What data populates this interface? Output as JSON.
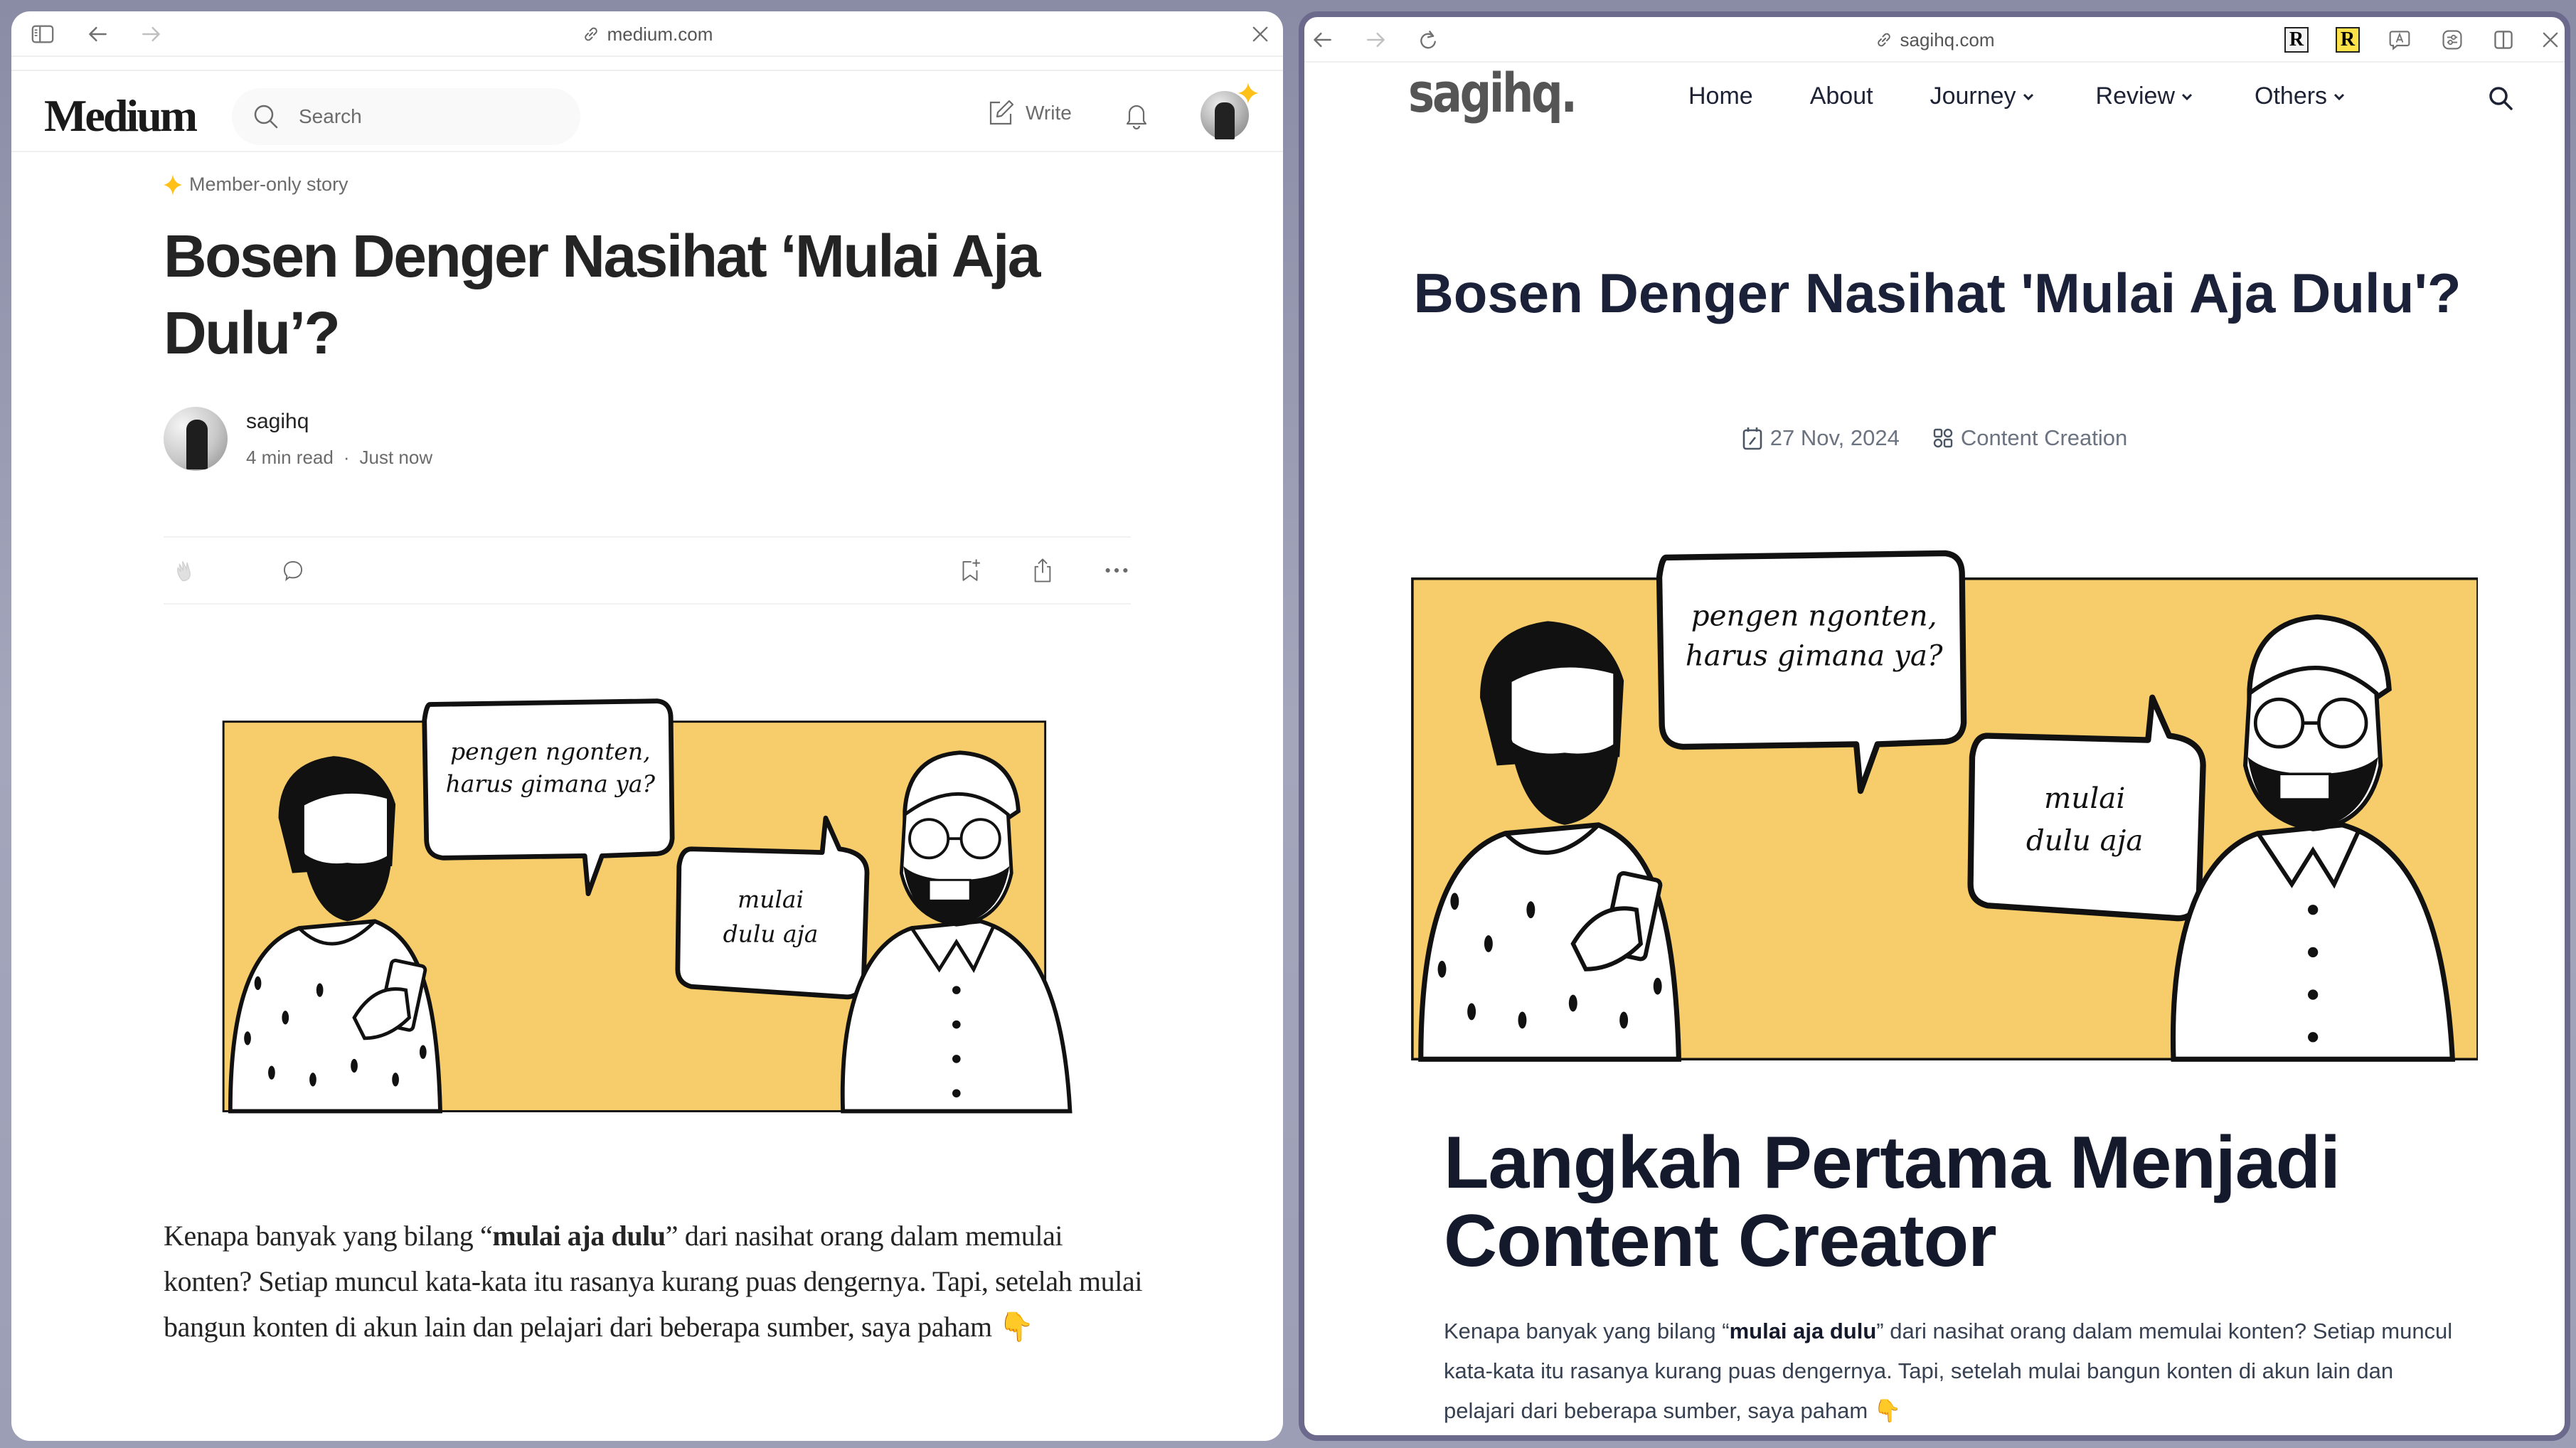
{
  "left_window": {
    "url": "medium.com",
    "chrome": {
      "icons": [
        "sidebar-icon",
        "back-arrow-icon",
        "forward-arrow-icon",
        "link-icon",
        "close-icon"
      ]
    },
    "header": {
      "logo": "Medium",
      "search_placeholder": "Search",
      "write_label": "Write"
    },
    "article": {
      "badge": "Member-only story",
      "title": "Bosen Denger Nasihat ‘Mulai Aja Dulu’?",
      "author": "sagihq",
      "read_time": "4 min read",
      "separator": "·",
      "published": "Just now",
      "illustration": {
        "bubble_left_line1": "pengen ngonten,",
        "bubble_left_line2": "harus gimana ya?",
        "bubble_right_line1": "mulai",
        "bubble_right_line2": "dulu aja"
      },
      "body_before": "Kenapa banyak yang bilang “",
      "body_bold": "mulai aja dulu",
      "body_after": "” dari nasihat orang dalam memulai konten? Setiap muncul kata-kata itu rasanya kurang puas dengernya. Tapi, setelah mulai bangun konten di akun lain dan pelajari dari beberapa sumber, saya paham 👇"
    }
  },
  "right_window": {
    "url": "sagihq.com",
    "chrome": {
      "extensions": [
        "R",
        "R"
      ],
      "icons": [
        "back-arrow-icon",
        "forward-arrow-icon",
        "reload-icon",
        "link-icon",
        "translate-icon",
        "settings-sliders-icon",
        "split-view-icon",
        "close-icon"
      ]
    },
    "header": {
      "logo": "sagihq.",
      "nav": [
        {
          "label": "Home",
          "dropdown": false
        },
        {
          "label": "About",
          "dropdown": false
        },
        {
          "label": "Journey",
          "dropdown": true
        },
        {
          "label": "Review",
          "dropdown": true
        },
        {
          "label": "Others",
          "dropdown": true
        }
      ]
    },
    "article": {
      "title": "Bosen Denger Nasihat 'Mulai Aja Dulu'?",
      "date": "27 Nov, 2024",
      "category": "Content Creation",
      "illustration": {
        "bubble_left_line1": "pengen ngonten,",
        "bubble_left_line2": "harus gimana ya?",
        "bubble_right_line1": "mulai",
        "bubble_right_line2": "dulu aja"
      },
      "heading": "Langkah Pertama Menjadi Content Creator",
      "body_before": "Kenapa banyak yang bilang “",
      "body_bold": "mulai aja dulu",
      "body_after": "” dari nasihat orang dalam memulai konten? Setiap muncul kata-kata itu rasanya kurang puas dengernya. Tapi, setelah mulai bangun konten di akun lain dan pelajari dari beberapa sumber, saya paham 👇"
    }
  },
  "colors": {
    "illustration_bg": "#f6cd6a",
    "medium_star": "#ffc017",
    "active_window_border": "#6b6a8c",
    "sagihq_heading": "#141a2b"
  }
}
